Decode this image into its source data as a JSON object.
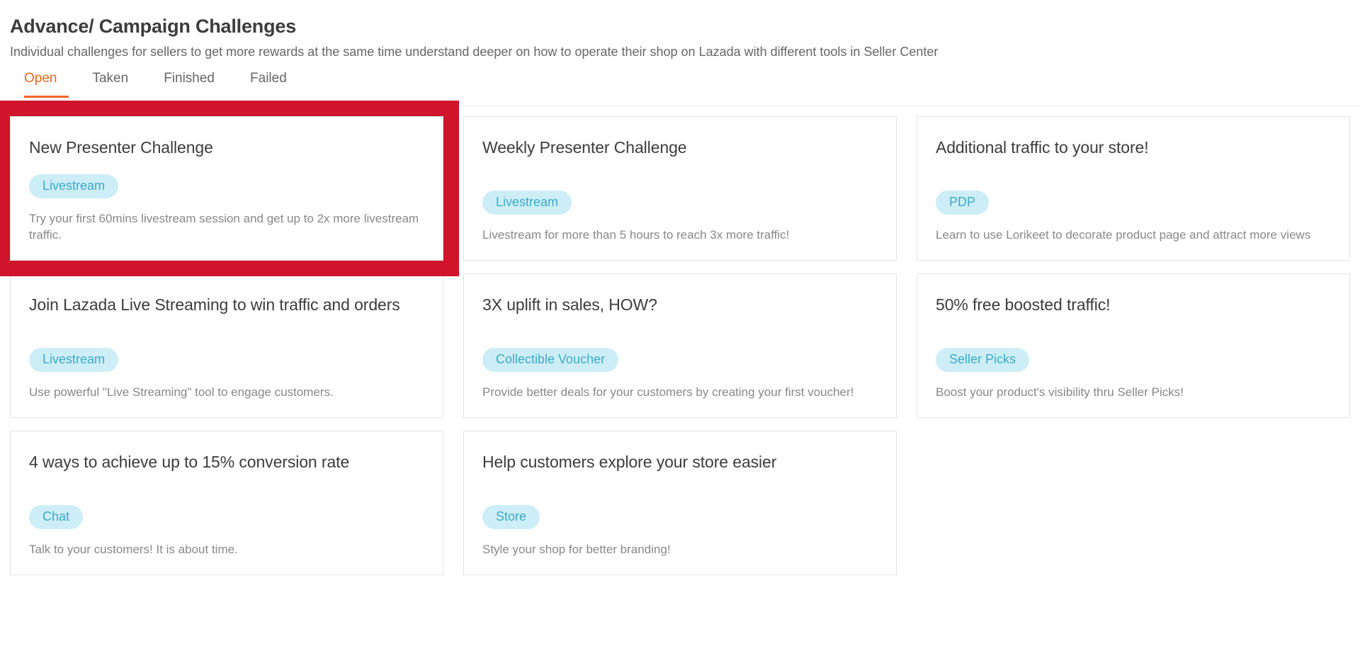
{
  "header": {
    "title": "Advance/ Campaign Challenges",
    "subtitle": "Individual challenges for sellers to get more rewards at the same time understand deeper on how to operate their shop on Lazada with different tools in Seller Center"
  },
  "tabs": [
    {
      "label": "Open",
      "active": true
    },
    {
      "label": "Taken",
      "active": false
    },
    {
      "label": "Finished",
      "active": false
    },
    {
      "label": "Failed",
      "active": false
    }
  ],
  "colors": {
    "accent": "#f26522",
    "highlight_border": "#cf142b",
    "badge_bg": "#cdeef6",
    "badge_text": "#3da9c9",
    "card_border": "#e4e4e4",
    "title_text": "#3c3c3c",
    "muted_text": "#888888"
  },
  "cards": [
    {
      "title": "New Presenter Challenge",
      "badge": "Livestream",
      "description": "Try your first 60mins livestream session and get up to 2x more livestream traffic.",
      "highlighted": true
    },
    {
      "title": "Weekly Presenter Challenge",
      "badge": "Livestream",
      "description": "Livestream for more than 5 hours to reach 3x more traffic!",
      "highlighted": false
    },
    {
      "title": "Additional traffic to your store!",
      "badge": "PDP",
      "description": "Learn to use Lorikeet to decorate product page and attract more views",
      "highlighted": false
    },
    {
      "title": "Join Lazada Live Streaming to win traffic and orders",
      "badge": "Livestream",
      "description": "Use powerful \"Live Streaming\" tool to engage customers.",
      "highlighted": false
    },
    {
      "title": "3X uplift in sales, HOW?",
      "badge": "Collectible Voucher",
      "description": "Provide better deals for your customers by creating your first voucher!",
      "highlighted": false
    },
    {
      "title": "50% free boosted traffic!",
      "badge": "Seller Picks",
      "description": "Boost your product's visibility thru Seller Picks!",
      "highlighted": false
    },
    {
      "title": "4 ways to achieve up to 15% conversion rate",
      "badge": "Chat",
      "description": "Talk to your customers! It is about time.",
      "highlighted": false
    },
    {
      "title": "Help customers explore your store easier",
      "badge": "Store",
      "description": "Style your shop for better branding!",
      "highlighted": false
    }
  ]
}
